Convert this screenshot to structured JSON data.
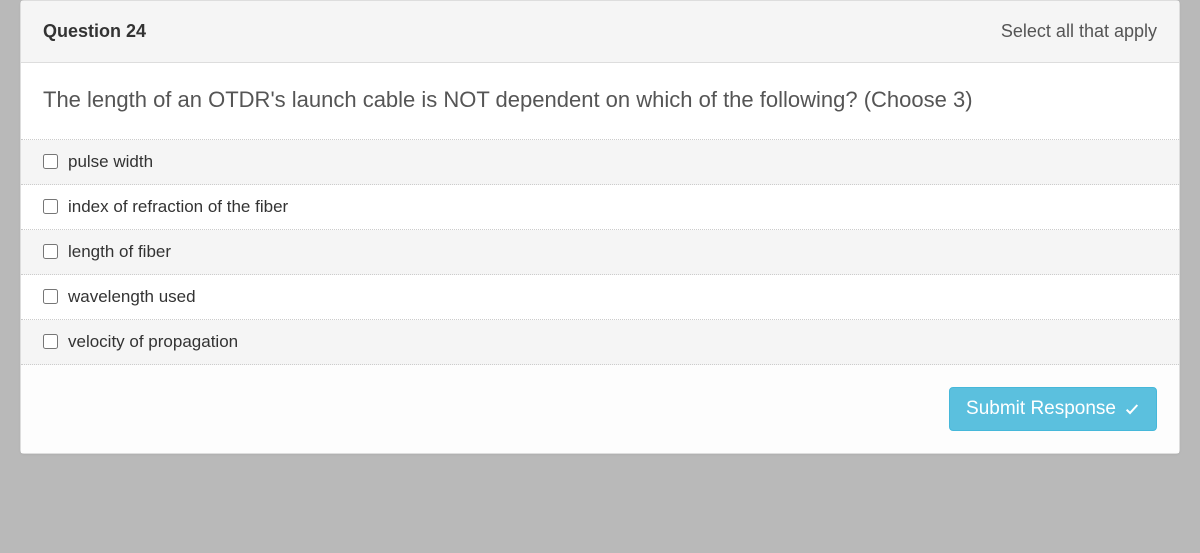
{
  "header": {
    "question_number": "Question 24",
    "hint": "Select all that apply"
  },
  "question": {
    "text": "The length of an OTDR's launch cable is NOT dependent on which of the following? (Choose 3)"
  },
  "options": [
    {
      "label": "pulse width"
    },
    {
      "label": "index of refraction of the fiber"
    },
    {
      "label": "length of fiber"
    },
    {
      "label": "wavelength used"
    },
    {
      "label": "velocity of propagation"
    }
  ],
  "footer": {
    "submit_label": "Submit Response"
  }
}
